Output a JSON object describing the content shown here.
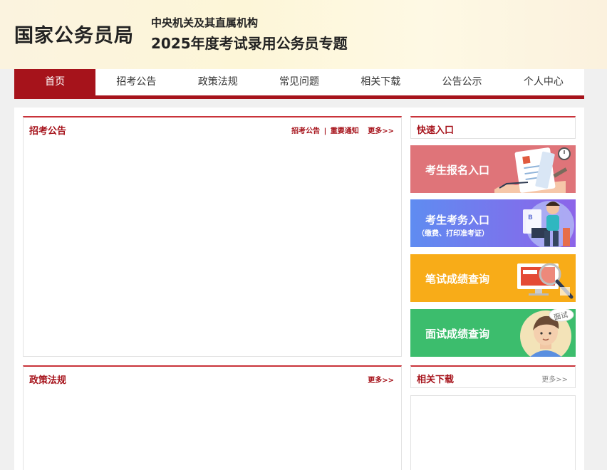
{
  "header": {
    "logo": "国家公务员局",
    "subtitle1": "中央机关及其直属机构",
    "subtitle2": "2025年度考试录用公务员专题"
  },
  "nav": {
    "items": [
      "首页",
      "招考公告",
      "政策法规",
      "常见问题",
      "相关下载",
      "公告公示",
      "个人中心"
    ],
    "active": "首页"
  },
  "announcements": {
    "title": "招考公告",
    "link1": "招考公告",
    "separator": "|",
    "link2": "重要通知",
    "more": "更多>>"
  },
  "quick": {
    "title": "快速入口",
    "banners": {
      "register": "考生报名入口",
      "affairs": "考生考务入口",
      "affairs_sub": "（缴费、打印准考证）",
      "written": "笔试成绩查询",
      "interview": "面试成绩查询",
      "interview_badge": "面试"
    }
  },
  "policy": {
    "title": "政策法规",
    "more": "更多>>"
  },
  "downloads": {
    "title": "相关下载",
    "more": "更多>>"
  },
  "colors": {
    "brand_red": "#a6131b",
    "register": "#df7479",
    "affairs": "#6f7bee",
    "written": "#f8ac18",
    "interview": "#3cbd6d"
  }
}
